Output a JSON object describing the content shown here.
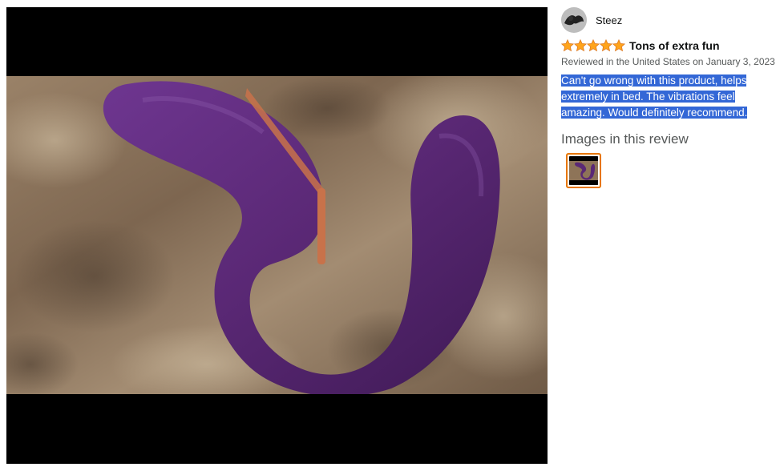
{
  "media": {
    "photo_alt": "",
    "colors": {
      "letterbox": "#000000",
      "countertop": "#8a6f55",
      "product": "#5b2a74",
      "accent": "#c8724a"
    }
  },
  "review": {
    "profile_name": "Steez",
    "rating": 5,
    "rating_max": 5,
    "star_color": "#ffa41c",
    "title": "Tons of extra fun",
    "date_line": "Reviewed in the United States on January 3, 2023",
    "body_lines": [
      "Can't go wrong with this product, helps",
      "extremely in bed. The vibrations feel",
      "amazing. Would definitely recommend."
    ],
    "selection_color": "#3367d6",
    "images_heading": "Images in this review",
    "thumbnail_border_color": "#e77600"
  }
}
